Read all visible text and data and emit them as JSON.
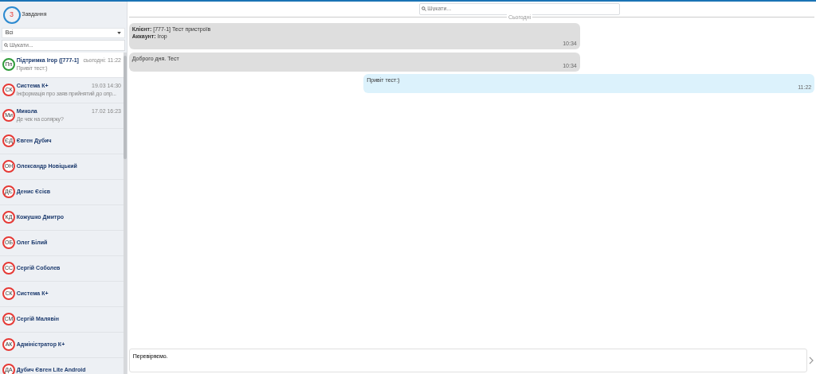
{
  "tasks": {
    "count": "3",
    "label": "Завдання"
  },
  "filter": {
    "value": "Всі"
  },
  "sidebar_search": {
    "placeholder": "Шукати..."
  },
  "conversations": [
    {
      "initials": "Пп",
      "name": "Підтримка Ігор ([777-1]",
      "time": "сьогодні: 11:22",
      "preview": "Привіт тест:)",
      "color": "#2e9a3a",
      "selected": true
    },
    {
      "initials": "СК",
      "name": "Система К+",
      "time": "19.03 14:30",
      "preview": "Інформація про заяв прийнятий до опр...",
      "color": "#e53935",
      "selected": false
    },
    {
      "initials": "Ми",
      "name": "Микола",
      "time": "17.02 16:23",
      "preview": "Де чек на солярку?",
      "color": "#e53935",
      "selected": false
    },
    {
      "initials": "ЄД",
      "name": "Євген Дубич",
      "color": "#e53935",
      "selected": false
    },
    {
      "initials": "ОН",
      "name": "Олександр Новіцький",
      "color": "#e53935",
      "selected": false
    },
    {
      "initials": "ДЄ",
      "name": "Денис Єсієв",
      "color": "#e53935",
      "selected": false
    },
    {
      "initials": "КД",
      "name": "Кожушко Дмитро",
      "color": "#e53935",
      "selected": false
    },
    {
      "initials": "ОБ",
      "name": "Олег Білий",
      "color": "#e53935",
      "selected": false
    },
    {
      "initials": "СС",
      "name": "Сергій Соболев",
      "color": "#e53935",
      "selected": false
    },
    {
      "initials": "СК",
      "name": "Система К+",
      "color": "#e53935",
      "selected": false
    },
    {
      "initials": "СМ",
      "name": "Сергій Малявін",
      "color": "#e53935",
      "selected": false
    },
    {
      "initials": "АК",
      "name": "Адміністратор К+",
      "color": "#e53935",
      "selected": false
    },
    {
      "initials": "ДА",
      "name": "Дубич Євген Lite Android",
      "color": "#e53935",
      "selected": false
    }
  ],
  "chat_search": {
    "placeholder": "Шукати..."
  },
  "date_divider": "Сьогодні",
  "messages": [
    {
      "kind": "incoming",
      "lines": [
        "**Клієнт:** [777-1] Тест пристроїв",
        "**Аккаунт:** Ігор"
      ],
      "time": "10:34"
    },
    {
      "kind": "incoming",
      "lines": [
        "Доброго дня. Тест"
      ],
      "time": "10:34"
    },
    {
      "kind": "outgoing",
      "lines": [
        "Привіт тест:)"
      ],
      "time": "11:22"
    }
  ],
  "composer": {
    "value": "Перевіряємо."
  }
}
